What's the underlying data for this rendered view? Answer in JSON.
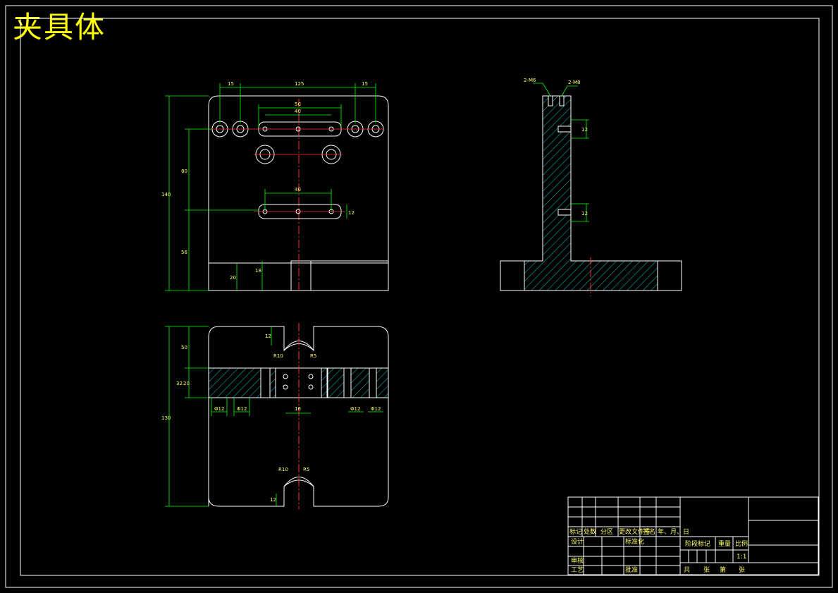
{
  "drawing": {
    "title": "夹具体"
  },
  "colors": {
    "background": "#000000",
    "outline": "#ffffff",
    "dimension": "#00ff00",
    "centerline": "#ff0000",
    "hatch": "#00ffff",
    "text": "#ffff00"
  },
  "dimensions": {
    "front_top": [
      "15",
      "125",
      "15"
    ],
    "front_inner": [
      "50",
      "40",
      "40"
    ],
    "front_height": [
      "140",
      "80",
      "56",
      "20",
      "18",
      "12"
    ],
    "side_slots": [
      "2-M6",
      "2-M8",
      "12",
      "12"
    ],
    "plan_vertical": [
      "12",
      "50",
      "32",
      "20",
      "130",
      "12"
    ],
    "plan_widths": [
      "Φ12",
      "Φ12",
      "16",
      "Φ12",
      "Φ12"
    ],
    "plan_radius": [
      "R10",
      "R5",
      "R10",
      "R5"
    ]
  },
  "title_block": {
    "row_labels": [
      "标记",
      "处数",
      "分区",
      "更改文件号",
      "签名",
      "年、月、日"
    ],
    "design": "设计",
    "standardization": "标准化",
    "review": "审核",
    "process": "工艺",
    "approve": "批准",
    "stage_mark": "阶段标记",
    "weight": "重量",
    "scale": "比例",
    "scale_value": "1:1",
    "sheet_total": "共",
    "sheet_zhang": "张",
    "sheet_no": "第",
    "sheet_zhang2": "张"
  }
}
